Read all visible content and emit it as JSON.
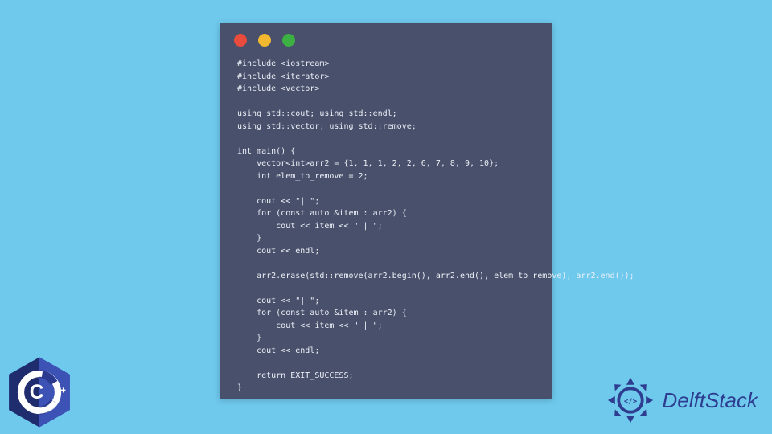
{
  "code": {
    "lines": [
      "#include <iostream>",
      "#include <iterator>",
      "#include <vector>",
      "",
      "using std::cout; using std::endl;",
      "using std::vector; using std::remove;",
      "",
      "int main() {",
      "    vector<int>arr2 = {1, 1, 1, 2, 2, 6, 7, 8, 9, 10};",
      "    int elem_to_remove = 2;",
      "",
      "    cout << \"| \";",
      "    for (const auto &item : arr2) {",
      "        cout << item << \" | \";",
      "    }",
      "    cout << endl;",
      "",
      "    arr2.erase(std::remove(arr2.begin(), arr2.end(), elem_to_remove), arr2.end());",
      "",
      "    cout << \"| \";",
      "    for (const auto &item : arr2) {",
      "        cout << item << \" | \";",
      "    }",
      "    cout << endl;",
      "",
      "    return EXIT_SUCCESS;",
      "}"
    ]
  },
  "window": {
    "traffic": {
      "red": "#e94b3c",
      "yellow": "#f2b82f",
      "green": "#3cb043"
    },
    "bg": "#48506b"
  },
  "badge": {
    "language": "C++",
    "plus": "++"
  },
  "brand": {
    "name": "DelftStack"
  }
}
